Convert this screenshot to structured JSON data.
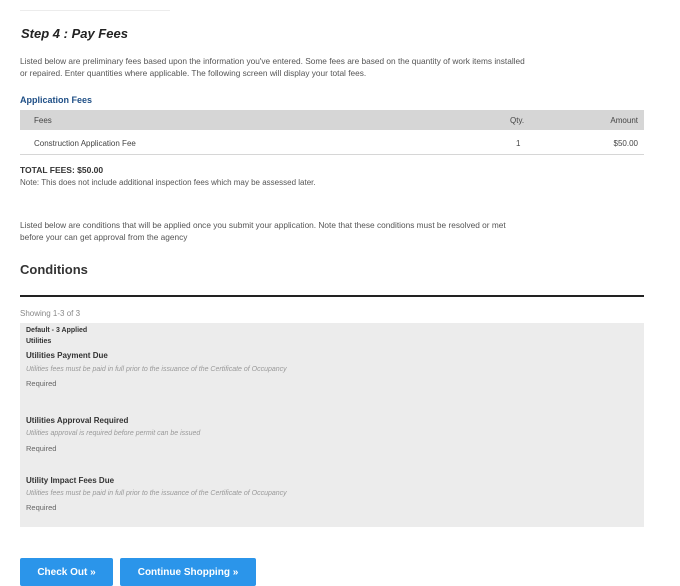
{
  "step": {
    "title": "Step 4 : Pay Fees"
  },
  "intro": {
    "line1": "Listed below are preliminary fees based upon the information you've entered. Some fees are based on the quantity of work items installed",
    "line2": "or repaired. Enter quantities where applicable. The following screen will display your total fees."
  },
  "fees": {
    "section_label": "Application Fees",
    "headers": {
      "fees": "Fees",
      "qty": "Qty.",
      "amount": "Amount"
    },
    "rows": [
      {
        "name": "Construction Application Fee",
        "qty": "1",
        "amount": "$50.00"
      }
    ],
    "total": "TOTAL FEES: $50.00",
    "note": "Note: This does not include additional inspection fees which may be assessed later."
  },
  "conditions_intro": {
    "line1": "Listed below are conditions that will be applied once you submit your application. Note that these conditions must be resolved or met",
    "line2": "before your can get approval from the agency"
  },
  "conditions": {
    "title": "Conditions",
    "showing": "Showing 1-3 of 3",
    "group_label": "Default - 3 Applied",
    "category": "Utilities",
    "items": [
      {
        "name": "Utilities Payment Due",
        "description": "Utilities fees must be paid in full prior to the issuance of the Certificate of Occupancy",
        "status": "Required"
      },
      {
        "name": "Utilities Approval Required",
        "description": "Utilities approval is required before permit can be issued",
        "status": "Required"
      },
      {
        "name": "Utility Impact Fees Due",
        "description": "Utilities fees must be paid in full prior to the issuance of the Certificate of Occupancy",
        "status": "Required"
      }
    ]
  },
  "buttons": {
    "checkout": "Check Out »",
    "continue_shopping": "Continue Shopping »"
  },
  "colors": {
    "accent": "#2b95ea",
    "section_label": "#1f4f86",
    "table_header": "#d6d6d6",
    "conditions_bg": "#ececec"
  }
}
